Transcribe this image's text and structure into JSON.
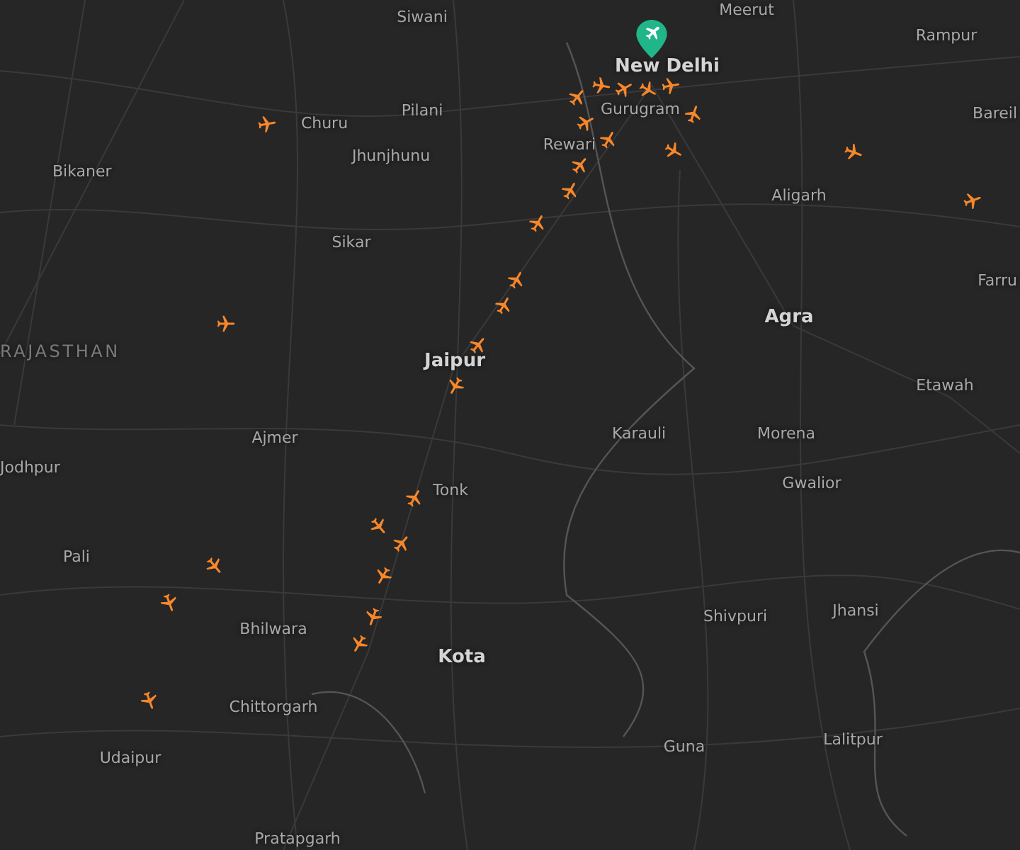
{
  "map": {
    "labels": [
      {
        "text": "Meerut",
        "kind": "city"
      },
      {
        "text": "Siwani",
        "kind": "city"
      },
      {
        "text": "Rampur",
        "kind": "city"
      },
      {
        "text": "New Delhi",
        "kind": "major"
      },
      {
        "text": "Pilani",
        "kind": "city"
      },
      {
        "text": "Gurugram",
        "kind": "city"
      },
      {
        "text": "Bareil",
        "kind": "city"
      },
      {
        "text": "Churu",
        "kind": "city"
      },
      {
        "text": "Rewari",
        "kind": "city"
      },
      {
        "text": "Jhunjhunu",
        "kind": "city"
      },
      {
        "text": "Bikaner",
        "kind": "city"
      },
      {
        "text": "Aligarh",
        "kind": "city"
      },
      {
        "text": "Sikar",
        "kind": "city"
      },
      {
        "text": "Farru",
        "kind": "city"
      },
      {
        "text": "Agra",
        "kind": "major"
      },
      {
        "text": "RAJASTHAN",
        "kind": "region"
      },
      {
        "text": "Jaipur",
        "kind": "major"
      },
      {
        "text": "Etawah",
        "kind": "city"
      },
      {
        "text": "Ajmer",
        "kind": "city"
      },
      {
        "text": "Karauli",
        "kind": "city"
      },
      {
        "text": "Morena",
        "kind": "city"
      },
      {
        "text": "Jodhpur",
        "kind": "city"
      },
      {
        "text": "Tonk",
        "kind": "city"
      },
      {
        "text": "Gwalior",
        "kind": "city"
      },
      {
        "text": "Pali",
        "kind": "city"
      },
      {
        "text": "Jhansi",
        "kind": "city"
      },
      {
        "text": "Shivpuri",
        "kind": "city"
      },
      {
        "text": "Bhilwara",
        "kind": "city"
      },
      {
        "text": "Kota",
        "kind": "major"
      },
      {
        "text": "Chittorgarh",
        "kind": "city"
      },
      {
        "text": "Lalitpur",
        "kind": "city"
      },
      {
        "text": "Guna",
        "kind": "city"
      },
      {
        "text": "Udaipur",
        "kind": "city"
      },
      {
        "text": "Pratapgarh",
        "kind": "city"
      }
    ]
  }
}
